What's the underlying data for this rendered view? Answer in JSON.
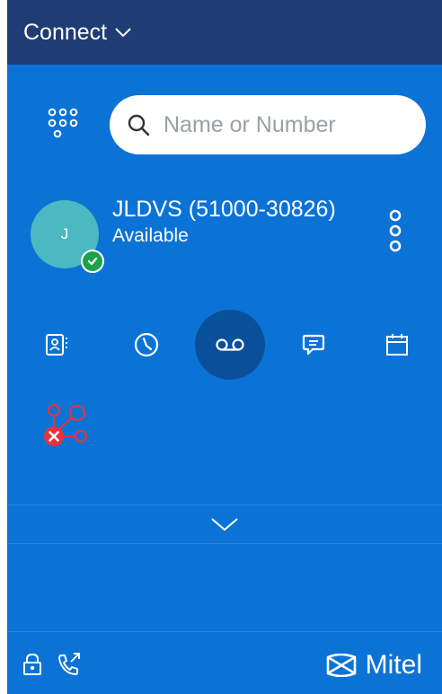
{
  "header": {
    "title": "Connect",
    "dropdown_icon": "chevron-down-icon"
  },
  "search": {
    "placeholder": "Name or Number",
    "value": ""
  },
  "user": {
    "initial": "J",
    "name": "JLDVS (51000-30826)",
    "status": "Available",
    "presence_color": "#1aa34a"
  },
  "nav": {
    "items": [
      {
        "name": "contacts",
        "icon": "contacts-book-icon"
      },
      {
        "name": "recent",
        "icon": "clock-icon"
      },
      {
        "name": "voicemail",
        "icon": "voicemail-icon",
        "active": true
      },
      {
        "name": "chat",
        "icon": "chat-bubble-icon"
      },
      {
        "name": "calendar",
        "icon": "calendar-icon"
      }
    ]
  },
  "integration": {
    "icon": "integration-disconnected-icon",
    "error_color": "#e8333a"
  },
  "footer": {
    "brand": "Mitel"
  },
  "colors": {
    "background": "#0c73d6",
    "header": "#1f3d74",
    "active_nav": "#0a4f9a"
  }
}
